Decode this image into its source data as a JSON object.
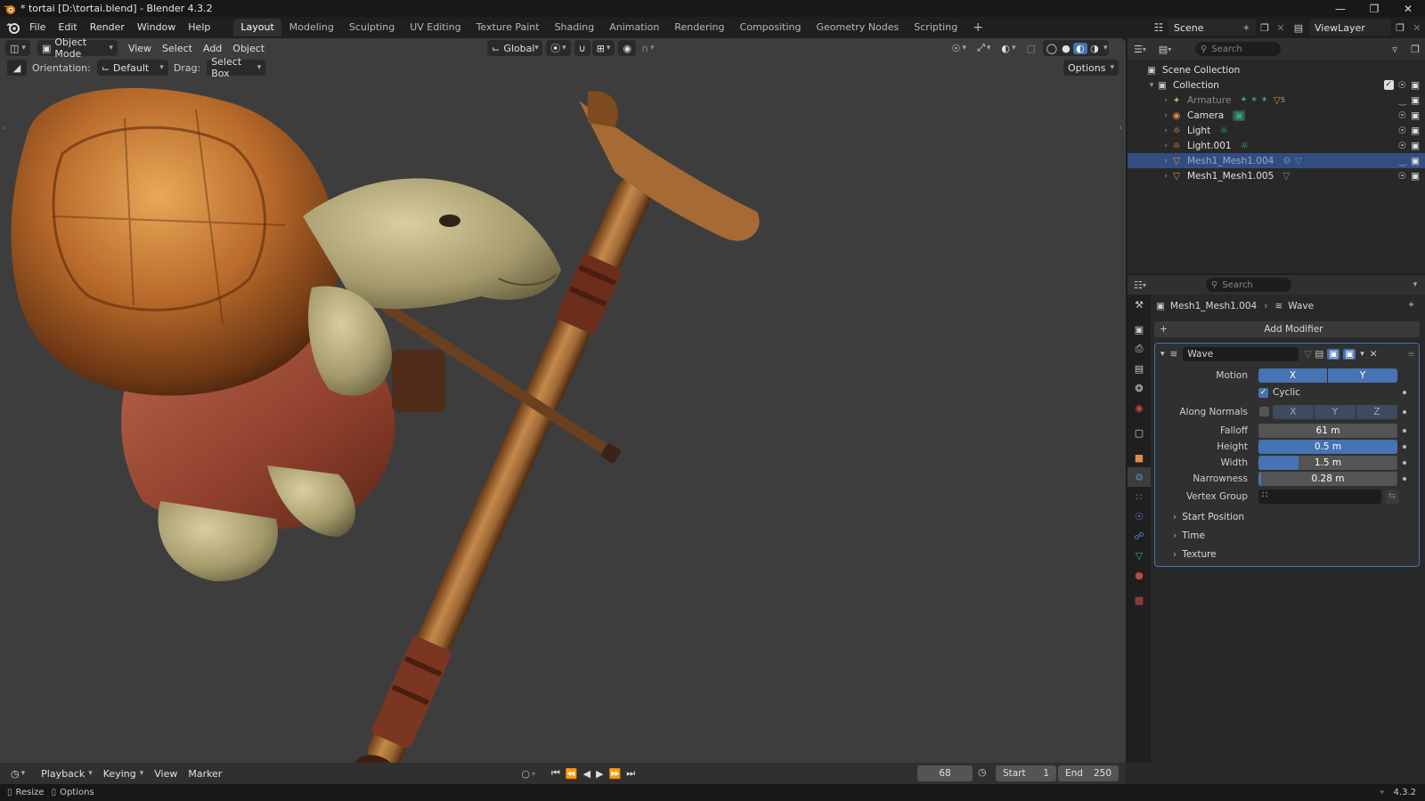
{
  "window": {
    "title": "* tortai [D:\\tortai.blend] - Blender 4.3.2"
  },
  "menu": {
    "items": [
      "File",
      "Edit",
      "Render",
      "Window",
      "Help"
    ]
  },
  "workspaces": {
    "tabs": [
      "Layout",
      "Modeling",
      "Sculpting",
      "UV Editing",
      "Texture Paint",
      "Shading",
      "Animation",
      "Rendering",
      "Compositing",
      "Geometry Nodes",
      "Scripting"
    ],
    "active": "Layout"
  },
  "scene": {
    "name": "Scene",
    "view_layer": "ViewLayer"
  },
  "viewport": {
    "mode": "Object Mode",
    "menus": [
      "View",
      "Select",
      "Add",
      "Object"
    ],
    "transform_orientation": "Global",
    "orientation_label": "Orientation:",
    "orientation_value": "Default",
    "drag_label": "Drag:",
    "drag_value": "Select Box",
    "options_label": "Options"
  },
  "outliner": {
    "search_placeholder": "Search",
    "scene_collection": "Scene Collection",
    "collection": "Collection",
    "items": [
      {
        "name": "Armature",
        "icon": "armature-icon",
        "dim": true
      },
      {
        "name": "Camera",
        "icon": "camera-icon",
        "dim": false
      },
      {
        "name": "Light",
        "icon": "light-icon",
        "dim": false
      },
      {
        "name": "Light.001",
        "icon": "light-icon",
        "dim": false
      },
      {
        "name": "Mesh1_Mesh1.004",
        "icon": "mesh-icon",
        "dim": true,
        "selected": true
      },
      {
        "name": "Mesh1_Mesh1.005",
        "icon": "mesh-icon",
        "dim": false
      }
    ],
    "armature_badge": "5"
  },
  "properties": {
    "search_placeholder": "Search",
    "breadcrumb_object": "Mesh1_Mesh1.004",
    "breadcrumb_modifier": "Wave",
    "add_modifier": "Add Modifier",
    "modifier": {
      "name": "Wave",
      "motion_label": "Motion",
      "motion_x": "X",
      "motion_y": "Y",
      "cyclic_label": "Cyclic",
      "cyclic_checked": true,
      "along_normals_label": "Along Normals",
      "along_normals_checked": false,
      "normals_x": "X",
      "normals_y": "Y",
      "normals_z": "Z",
      "falloff_label": "Falloff",
      "falloff_value": "61 m",
      "height_label": "Height",
      "height_value": "0.5 m",
      "width_label": "Width",
      "width_value": "1.5 m",
      "narrowness_label": "Narrowness",
      "narrowness_value": "0.28 m",
      "vertex_group_label": "Vertex Group",
      "vertex_group_value": ""
    },
    "subpanels": [
      "Start Position",
      "Time",
      "Texture"
    ]
  },
  "timeline": {
    "menus": [
      "Playback",
      "Keying",
      "View",
      "Marker"
    ],
    "current_frame": "68",
    "start_label": "Start",
    "start_value": "1",
    "end_label": "End",
    "end_value": "250"
  },
  "statusbar": {
    "resize": "Resize",
    "options": "Options",
    "version": "4.3.2"
  },
  "colors": {
    "accent": "#4772b3",
    "selection": "#334d80",
    "viewport_bg": "#3d3d3d",
    "panel_bg": "#282828"
  }
}
